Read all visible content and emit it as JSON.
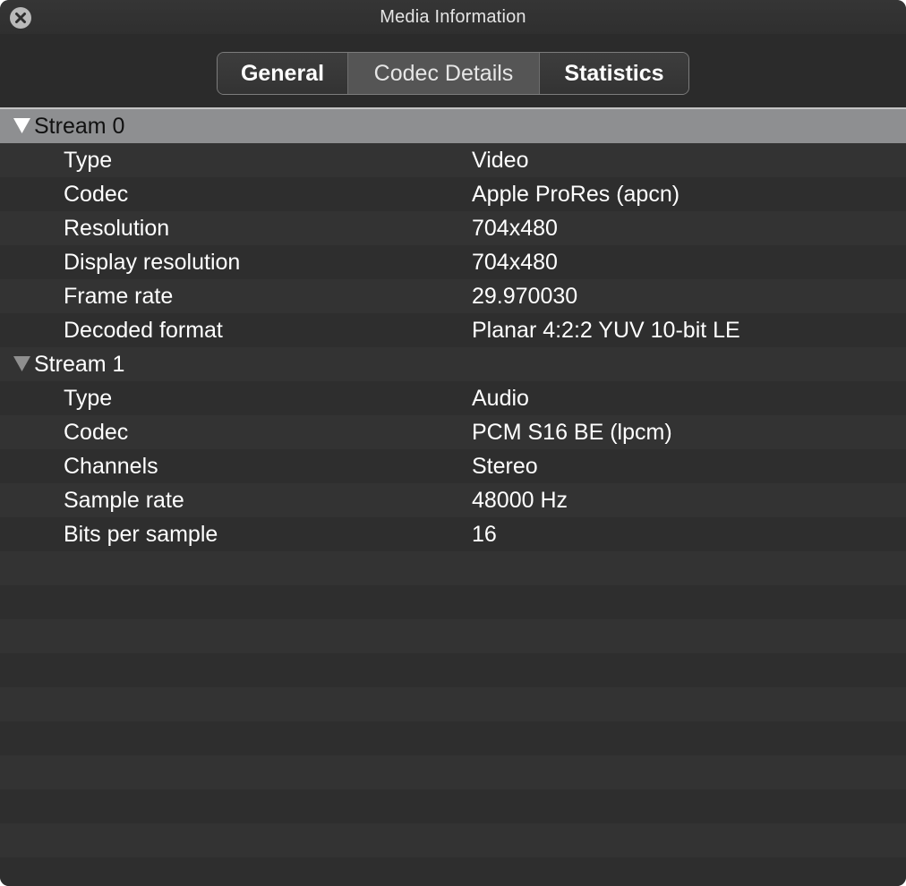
{
  "window": {
    "title": "Media Information"
  },
  "tabs": [
    {
      "label": "General"
    },
    {
      "label": "Codec Details"
    },
    {
      "label": "Statistics"
    }
  ],
  "streams": [
    {
      "label": "Stream 0",
      "rows": [
        {
          "label": "Type",
          "value": "Video"
        },
        {
          "label": "Codec",
          "value": "Apple ProRes (apcn)"
        },
        {
          "label": "Resolution",
          "value": "704x480"
        },
        {
          "label": "Display resolution",
          "value": "704x480"
        },
        {
          "label": "Frame rate",
          "value": "29.970030"
        },
        {
          "label": "Decoded format",
          "value": "Planar 4:2:2 YUV 10-bit LE"
        }
      ]
    },
    {
      "label": "Stream 1",
      "rows": [
        {
          "label": "Type",
          "value": "Audio"
        },
        {
          "label": "Codec",
          "value": "PCM S16 BE (lpcm)"
        },
        {
          "label": "Channels",
          "value": "Stereo"
        },
        {
          "label": "Sample rate",
          "value": "48000 Hz"
        },
        {
          "label": "Bits per sample",
          "value": "16"
        }
      ]
    }
  ]
}
